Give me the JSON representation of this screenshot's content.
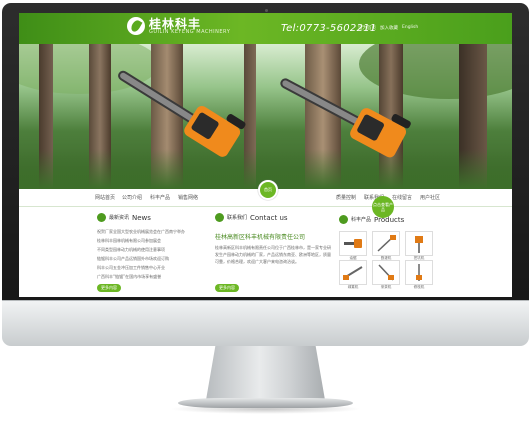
{
  "site": {
    "logo_cn": "桂林科丰",
    "logo_en": "GUILIN KEFENG MACHINERY",
    "phone": "Tel:0773-5602211",
    "top_links": [
      "设为首页",
      "加入收藏",
      "English"
    ]
  },
  "nav": [
    "网站首页",
    "公司介绍",
    "科丰产品",
    "销售网络",
    "质量控制",
    "联系我们",
    "在线留言",
    "用户社区"
  ],
  "nav_center_label": "首页",
  "news": {
    "title_cn": "最新资讯",
    "title_en": "News",
    "items": [
      "祝贺厂家全国大型农业机械展览会在广西南宁举办",
      "桂林科丰园林机械有限公司参加展会",
      "不同类型园林动力机械的使用注意事项",
      "链锯科丰公司产品远销国外市场欢迎订购",
      "科丰公司五金冲压加工件销售中心开业",
      "广西科丰“链锯”在国内市场享有盛誉"
    ],
    "more_label": "更多内容"
  },
  "contact": {
    "title_cn": "联系我们",
    "title_en": "Contact us",
    "company": "桂林高新区科丰机械有限责任公司",
    "text": "桂林高新区科丰机械有限责任公司位于广西桂林市，是一家专业研发生产园林动力机械的厂家，产品远销东南亚、欧洲等地区，质量可靠，价格合理，欢迎广大客户来电咨询洽谈。",
    "more_label": "更多内容"
  },
  "products": {
    "title_cn": "科丰产品",
    "title_en": "Products",
    "ribbon": "点击查看产品",
    "items": [
      "油锯",
      "割灌机",
      "挖坑机",
      "绿篱机",
      "采茶机",
      "修枝机"
    ]
  }
}
